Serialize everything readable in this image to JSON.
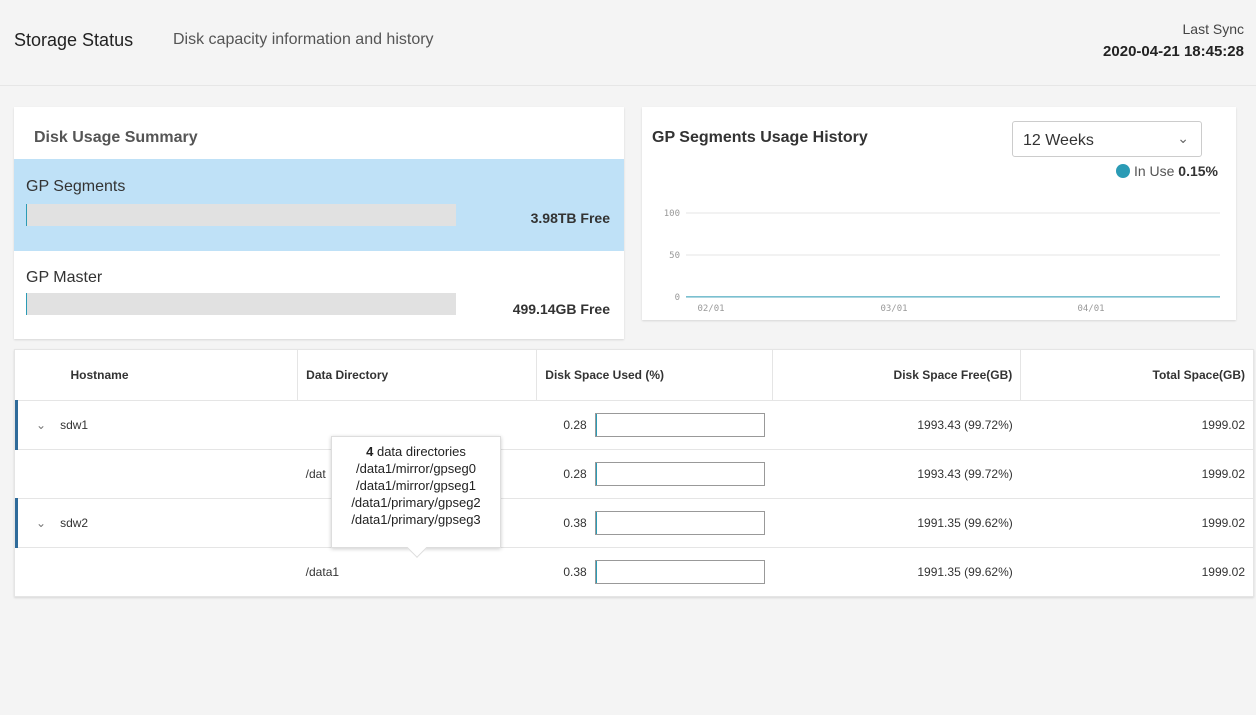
{
  "header": {
    "title": "Storage Status",
    "subtitle": "Disk capacity information and history",
    "sync_label": "Last Sync",
    "sync_value": "2020-04-21 18:45:28"
  },
  "summary": {
    "title": "Disk Usage Summary",
    "rows": [
      {
        "name": "GP Segments",
        "free": "3.98TB Free",
        "used_fraction": 0.0015,
        "selected": true
      },
      {
        "name": "GP Master",
        "free": "499.14GB Free",
        "used_fraction": 0.0,
        "selected": false
      }
    ]
  },
  "history": {
    "title": "GP Segments Usage History",
    "range_select": "12 Weeks",
    "legend_label": "In Use",
    "legend_value": "0.15%",
    "chart_data": {
      "type": "line",
      "y_ticks": [
        "100",
        "50",
        "0"
      ],
      "x_ticks": [
        "02/01",
        "03/01",
        "04/01"
      ],
      "ylim": [
        0,
        100
      ],
      "series": [
        {
          "name": "In Use",
          "values": [
            0.15,
            0.15,
            0.15
          ],
          "color": "#2b9bb5"
        }
      ]
    }
  },
  "table": {
    "columns": [
      "Hostname",
      "Data Directory",
      "Disk Space Used (%)",
      "Disk Space Free(GB)",
      "Total Space(GB)"
    ],
    "rows": [
      {
        "type": "host",
        "hostname": "sdw1",
        "directory": "",
        "used": "0.28",
        "used_fraction": 0.0028,
        "free": "1993.43 (99.72%)",
        "total": "1999.02"
      },
      {
        "type": "dir",
        "hostname": "",
        "directory": "/dat",
        "used": "0.28",
        "used_fraction": 0.0028,
        "free": "1993.43 (99.72%)",
        "total": "1999.02"
      },
      {
        "type": "host",
        "hostname": "sdw2",
        "directory": "",
        "used": "0.38",
        "used_fraction": 0.0038,
        "free": "1991.35 (99.62%)",
        "total": "1999.02"
      },
      {
        "type": "dir",
        "hostname": "",
        "directory": "/data1",
        "used": "0.38",
        "used_fraction": 0.0038,
        "free": "1991.35 (99.62%)",
        "total": "1999.02"
      }
    ]
  },
  "tooltip": {
    "count": "4",
    "count_suffix": " data directories",
    "lines": [
      "/data1/mirror/gpseg0",
      "/data1/mirror/gpseg1",
      "/data1/primary/gpseg2",
      "/data1/primary/gpseg3"
    ]
  }
}
